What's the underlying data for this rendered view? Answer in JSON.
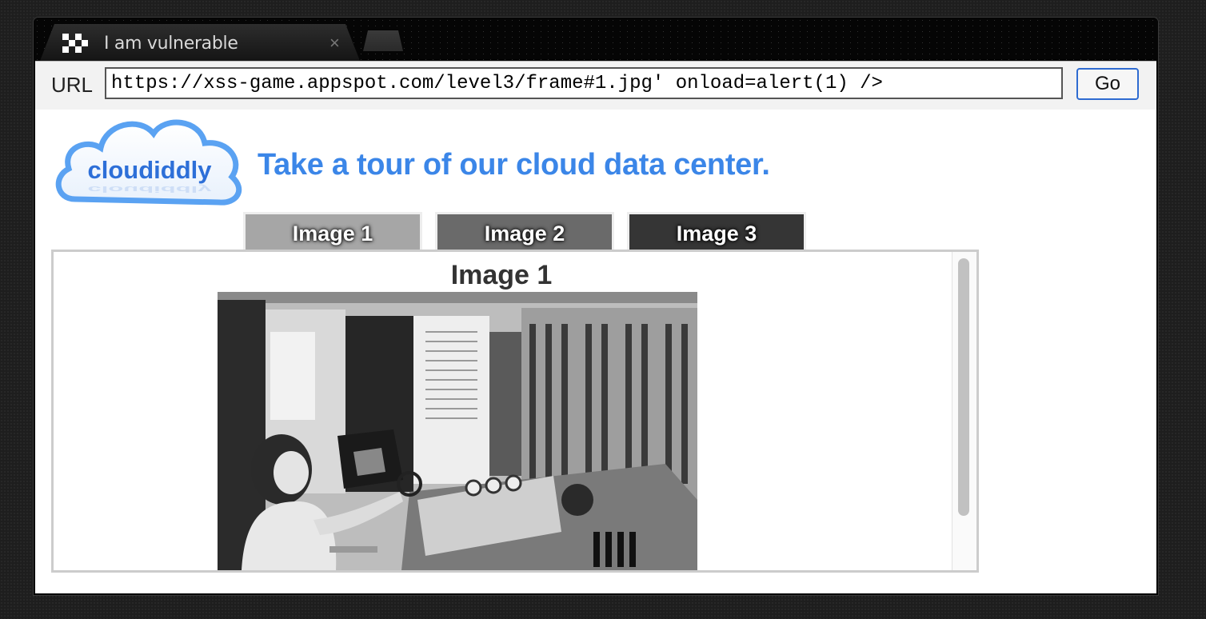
{
  "browser": {
    "tab_title": "I am vulnerable",
    "tab_close": "×",
    "url_label": "URL",
    "url_value": "https://xss-game.appspot.com/level3/frame#1.jpg' onload=alert(1) />",
    "go_label": "Go"
  },
  "page": {
    "logo_text": "cloudiddly",
    "headline": "Take a tour of our cloud data center.",
    "accent_color": "#3b86e8",
    "tabs": [
      {
        "label": "Image 1",
        "color": "#a6a6a6"
      },
      {
        "label": "Image 2",
        "color": "#6a6a6a"
      },
      {
        "label": "Image 3",
        "color": "#353535"
      }
    ],
    "panel_title": "Image 1",
    "photo_icon": "vintage-computer-photo"
  }
}
